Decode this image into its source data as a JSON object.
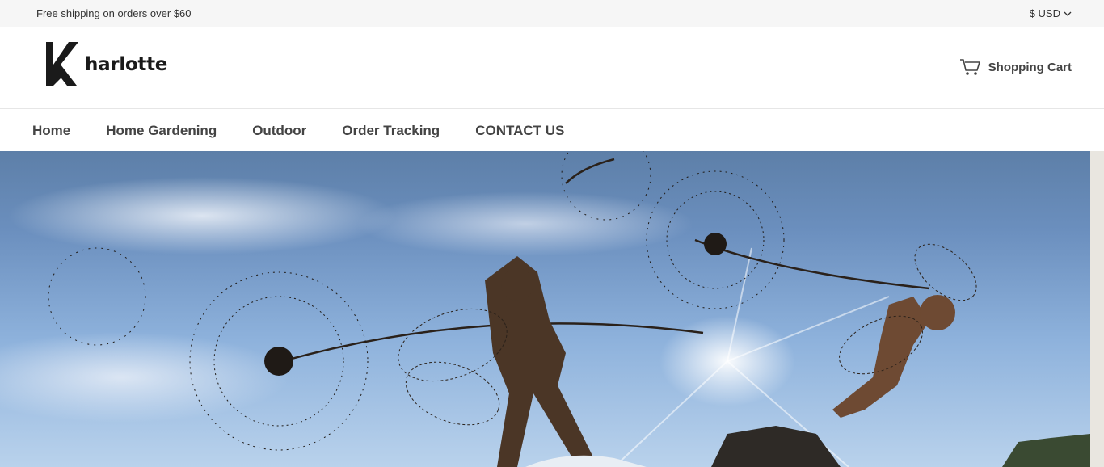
{
  "topbar": {
    "shipping_notice": "Free shipping on orders over $60",
    "currency": "$ USD",
    "currency_icon": "chevron-down-icon"
  },
  "header": {
    "logo_text": "harlotte",
    "cart_label": "Shopping Cart",
    "cart_icon": "shopping-cart-icon"
  },
  "nav": {
    "items": [
      {
        "label": "Home"
      },
      {
        "label": "Home Gardening"
      },
      {
        "label": "Outdoor"
      },
      {
        "label": "Order Tracking"
      },
      {
        "label": "CONTACT US"
      }
    ]
  },
  "hero": {
    "image": "dandelion-fairy-sculptures-photo"
  }
}
